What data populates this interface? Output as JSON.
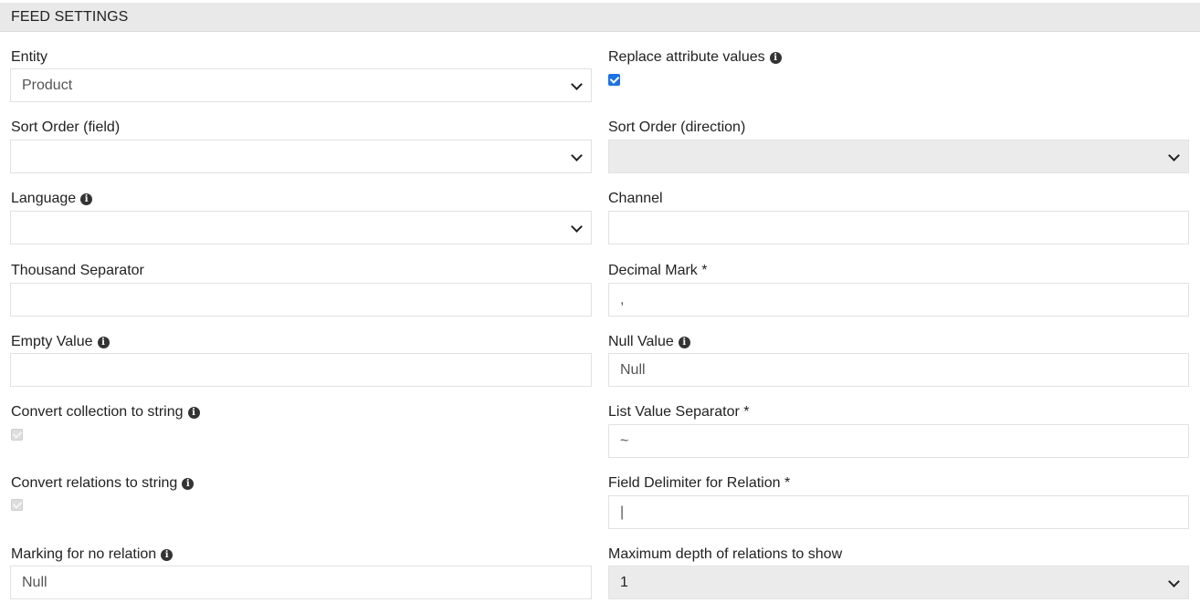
{
  "header": {
    "title": "FEED SETTINGS"
  },
  "left": {
    "entity": {
      "label": "Entity",
      "value": "Product"
    },
    "sort_field": {
      "label": "Sort Order (field)",
      "value": ""
    },
    "language": {
      "label": "Language",
      "value": ""
    },
    "thousand_separator": {
      "label": "Thousand Separator",
      "value": ""
    },
    "empty_value": {
      "label": "Empty Value",
      "value": ""
    },
    "convert_collection": {
      "label": "Convert collection to string",
      "checked": true,
      "disabled": true
    },
    "convert_relations": {
      "label": "Convert relations to string",
      "checked": true,
      "disabled": true
    },
    "no_relation_marking": {
      "label": "Marking for no relation",
      "value": "Null"
    }
  },
  "right": {
    "replace_attributes": {
      "label": "Replace attribute values",
      "checked": true
    },
    "sort_direction": {
      "label": "Sort Order (direction)",
      "value": ""
    },
    "channel": {
      "label": "Channel",
      "value": ""
    },
    "decimal_mark": {
      "label": "Decimal Mark *",
      "value": ","
    },
    "null_value": {
      "label": "Null Value",
      "value": "Null"
    },
    "list_separator": {
      "label": "List Value Separator *",
      "value": "~"
    },
    "relation_delimiter": {
      "label": "Field Delimiter for Relation *",
      "value": "|"
    },
    "max_depth": {
      "label": "Maximum depth of relations to show",
      "value": "1"
    }
  },
  "icons": {
    "info": "info-circle-icon",
    "dropdown": "chevron-down-icon",
    "check": "checkbox-check-icon"
  },
  "colors": {
    "header_bg": "#e9e9e9",
    "checkbox_active": "#1a73e8",
    "readonly_bg": "#ebebeb"
  }
}
